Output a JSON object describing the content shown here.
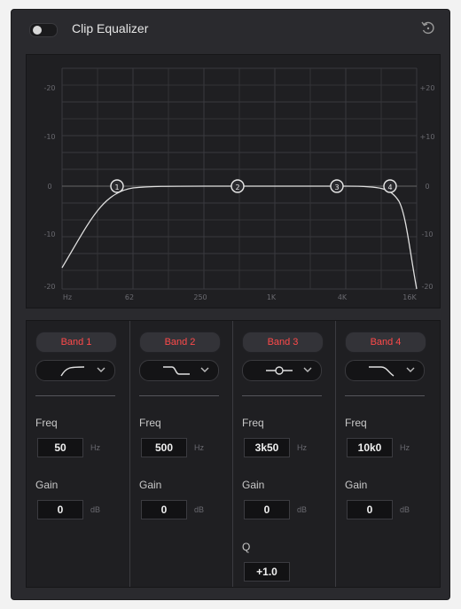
{
  "panel": {
    "title": "Clip Equalizer",
    "toggle_state": "off",
    "reset_icon": "reset-icon"
  },
  "graph": {
    "y_ticks_left": [
      "-20",
      "-10",
      "0",
      "-10",
      "-20"
    ],
    "y_ticks_right": [
      "+20",
      "+10",
      "0",
      "-10",
      "-20"
    ],
    "x_ticks": [
      "Hz",
      "62",
      "250",
      "1K",
      "4K",
      "16K"
    ],
    "nodes": [
      "1",
      "2",
      "3",
      "4"
    ],
    "curve_color": "#e0e0e0"
  },
  "bands": [
    {
      "label": "Band 1",
      "filter_icon": "high-pass-icon",
      "freq": "50",
      "freq_unit": "Hz",
      "gain": "0",
      "gain_unit": "dB"
    },
    {
      "label": "Band 2",
      "filter_icon": "low-shelf-icon",
      "freq": "500",
      "freq_unit": "Hz",
      "gain": "0",
      "gain_unit": "dB"
    },
    {
      "label": "Band 3",
      "filter_icon": "bell-icon",
      "freq": "3k50",
      "freq_unit": "Hz",
      "gain": "0",
      "gain_unit": "dB",
      "q_label": "Q",
      "q": "+1.0"
    },
    {
      "label": "Band 4",
      "filter_icon": "low-pass-icon",
      "freq": "10k0",
      "freq_unit": "Hz",
      "gain": "0",
      "gain_unit": "dB"
    }
  ],
  "labels": {
    "freq": "Freq",
    "gain": "Gain"
  },
  "colors": {
    "band_label": "#ff4a4a",
    "panel_bg": "#2a2a2e"
  }
}
